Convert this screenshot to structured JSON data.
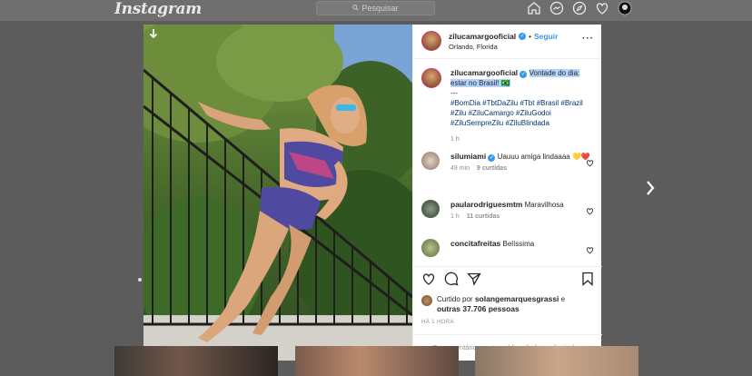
{
  "nav": {
    "logo": "Instagram",
    "search_placeholder": "Pesquisar",
    "icons": [
      "home-icon",
      "messenger-icon",
      "explore-icon",
      "activity-heart-icon",
      "profile-avatar"
    ]
  },
  "post": {
    "author": "zilucamargooficial",
    "follow_label": "Seguir",
    "location": "Orlando, Florida",
    "caption_user": "zilucamargooficial",
    "caption_highlight": "Vontade do dia: estar no Brasil! 🇧🇷",
    "caption_sep": "---",
    "hashtags": "#BomDia #TbtDaZilu #Tbt #Brasil #Brazil #Zilu #ZiluCamargo #ZiluGodoi #ZiluSempreZilu #ZiluBlindada",
    "caption_time": "1 h",
    "likes_prefix": "Curtido por",
    "likes_user": "solangemarquesgrassi",
    "likes_and": "e",
    "likes_others": "outras 37.706 pessoas",
    "post_time": "HÁ 1 HORA",
    "comments_limited": "Os comentários nesta publicação foram limitados."
  },
  "comments": [
    {
      "user": "silumiami",
      "text": "Uauuu amiga lindaaaa 💛❤️",
      "time": "49 min",
      "likes": "9 curtidas"
    },
    {
      "user": "paularodriguesmtm",
      "text": "Maravilhosa",
      "time": "1 h",
      "likes": "11 curtidas"
    },
    {
      "user": "concitafreitas",
      "text": "Belíssima",
      "time": "",
      "likes": ""
    }
  ],
  "colors": {
    "accent": "#3897f0",
    "verified": "#3897f0",
    "highlight": "#b3d4fc"
  }
}
